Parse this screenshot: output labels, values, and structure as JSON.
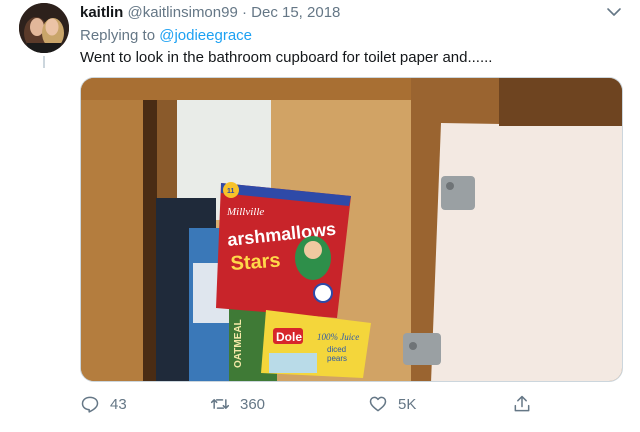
{
  "tweet": {
    "display_name": "kaitlin",
    "handle": "@kaitlinsimon99",
    "separator": "·",
    "date": "Dec 15, 2018",
    "replying_to_label": "Replying to",
    "replying_to_handle": "@jodieegrace",
    "text": "Went to look in the bathroom cupboard for toilet paper and......"
  },
  "media": {
    "box_brand": "Millville",
    "box_badge": "11",
    "box_title_1": "arshmallows",
    "box_title_2": "Stars",
    "cup_brand": "Dole",
    "cup_label_1": "100% Juice",
    "cup_label_2": "diced",
    "cup_label_3": "pears",
    "oatmeal_label": "OATMEAL"
  },
  "actions": {
    "reply_count": "43",
    "retweet_count": "360",
    "like_count": "5K"
  },
  "colors": {
    "link": "#1da1f2",
    "secondary": "#657786",
    "wood": "#b07a3c"
  }
}
